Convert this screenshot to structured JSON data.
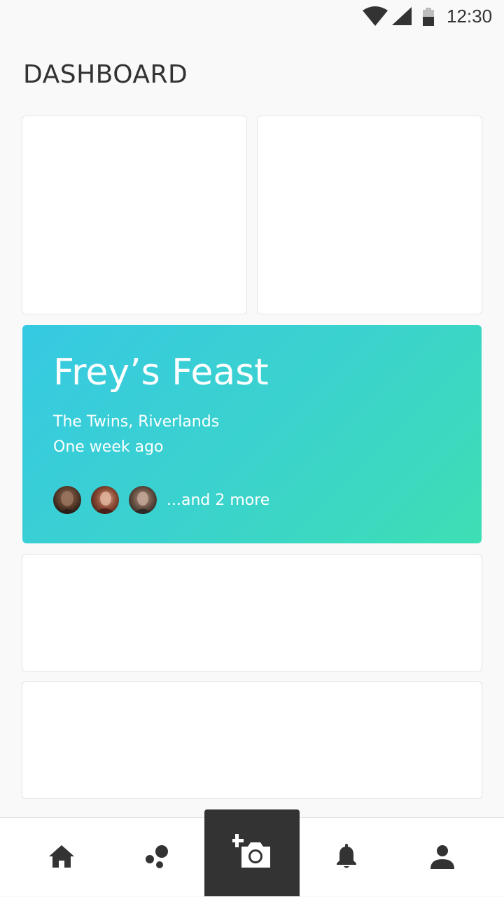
{
  "status_bar": {
    "time": "12:30",
    "icons": [
      "wifi-icon",
      "signal-icon",
      "battery-icon"
    ]
  },
  "header": {
    "title": "DASHBOARD"
  },
  "event_card": {
    "title": "Frey’s Feast",
    "location": "The Twins, Riverlands",
    "time_ago": "One week ago",
    "attendees_more": "...and 2 more",
    "gradient_colors": [
      "#36c9e3",
      "#3ddfb4"
    ]
  },
  "bottom_nav": {
    "items": [
      {
        "icon": "home-icon"
      },
      {
        "icon": "discover-icon"
      },
      {
        "icon": "add-photo-icon"
      },
      {
        "icon": "bell-icon"
      },
      {
        "icon": "user-icon"
      }
    ],
    "active_bg": "#333333"
  }
}
